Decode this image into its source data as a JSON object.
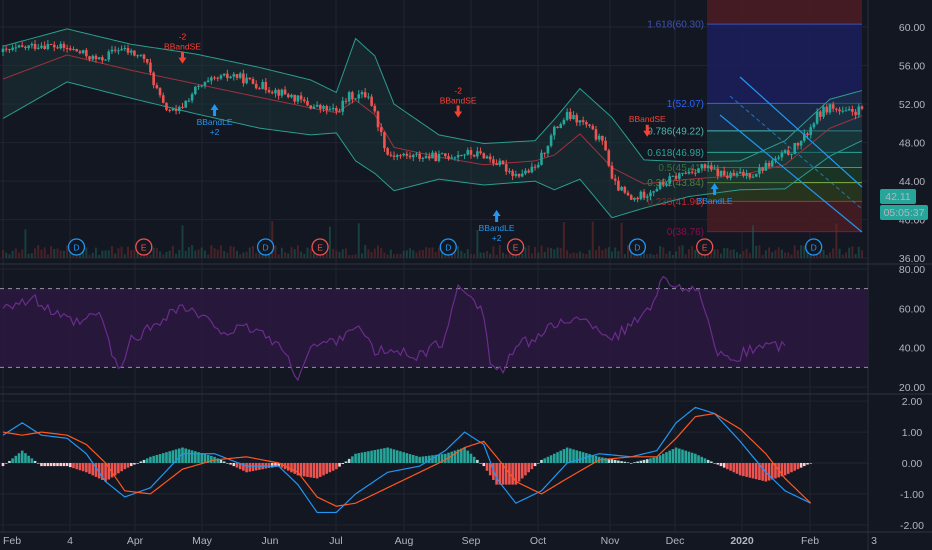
{
  "colors": {
    "background": "#131722",
    "grid": "#1f2430",
    "up": "#26a69a",
    "down": "#ef5350",
    "bb": "#2a9d8f",
    "bb_fill": "#1a3a3a",
    "bb_basis": "#a03040",
    "rsi": "#6b2c8c",
    "rsi_band": "#2a1840",
    "macd": "#2196f3",
    "signal": "#ff5722",
    "fib_blue": "#3f51b5",
    "axis_text": "#b2b5be",
    "price_tag": "#26a69a"
  },
  "chart_data": [
    {
      "type": "line",
      "panel": "price",
      "chart_style": "candlestick with Bollinger Bands",
      "x_labels": [
        "Feb",
        "4",
        "Apr",
        "May",
        "Jun",
        "Jul",
        "Aug",
        "Sep",
        "Oct",
        "Nov",
        "Dec",
        "2020",
        "Feb",
        "3"
      ],
      "y_ticks": [
        "60.00",
        "56.00",
        "52.00",
        "48.00",
        "44.00",
        "40.00",
        "36.00"
      ],
      "ylim": [
        35.5,
        62.8
      ],
      "x_index_range": [
        0,
        268
      ],
      "close_path": [
        [
          0,
          57.4
        ],
        [
          12,
          58.2
        ],
        [
          22,
          57.6
        ],
        [
          30,
          56.5
        ],
        [
          36,
          57.8
        ],
        [
          44,
          56.8
        ],
        [
          50,
          51.8
        ],
        [
          54,
          51.0
        ],
        [
          60,
          53.5
        ],
        [
          66,
          54.5
        ],
        [
          72,
          55.0
        ],
        [
          78,
          54.2
        ],
        [
          84,
          53.5
        ],
        [
          90,
          52.8
        ],
        [
          96,
          51.8
        ],
        [
          104,
          51.2
        ],
        [
          108,
          52.8
        ],
        [
          114,
          53.0
        ],
        [
          116,
          51.0
        ],
        [
          120,
          46.8
        ],
        [
          126,
          46.6
        ],
        [
          136,
          46.5
        ],
        [
          144,
          46.9
        ],
        [
          150,
          46.7
        ],
        [
          160,
          44.7
        ],
        [
          166,
          45.2
        ],
        [
          172,
          49.3
        ],
        [
          176,
          50.8
        ],
        [
          182,
          49.8
        ],
        [
          188,
          47.5
        ],
        [
          190,
          44.0
        ],
        [
          196,
          42.0
        ],
        [
          202,
          43.0
        ],
        [
          210,
          44.5
        ],
        [
          218,
          45.5
        ],
        [
          226,
          44.5
        ],
        [
          234,
          44.8
        ],
        [
          240,
          46.0
        ],
        [
          246,
          47.2
        ],
        [
          250,
          48.5
        ],
        [
          254,
          50.8
        ],
        [
          258,
          51.8
        ],
        [
          262,
          51.0
        ],
        [
          268,
          51.4
        ]
      ],
      "bb_upper_path": [
        [
          0,
          58.0
        ],
        [
          20,
          59.8
        ],
        [
          40,
          58.2
        ],
        [
          60,
          57.2
        ],
        [
          80,
          55.8
        ],
        [
          96,
          54.5
        ],
        [
          104,
          53.2
        ],
        [
          110,
          58.8
        ],
        [
          116,
          57.0
        ],
        [
          122,
          52.0
        ],
        [
          136,
          48.8
        ],
        [
          150,
          47.9
        ],
        [
          166,
          48.2
        ],
        [
          172,
          50.4
        ],
        [
          180,
          53.6
        ],
        [
          190,
          50.6
        ],
        [
          200,
          46.2
        ],
        [
          214,
          46.0
        ],
        [
          230,
          46.1
        ],
        [
          244,
          48.2
        ],
        [
          258,
          52.5
        ],
        [
          268,
          53.4
        ]
      ],
      "bb_lower_path": [
        [
          0,
          50.5
        ],
        [
          20,
          54.3
        ],
        [
          40,
          52.6
        ],
        [
          60,
          51.0
        ],
        [
          80,
          49.5
        ],
        [
          96,
          48.8
        ],
        [
          104,
          49.0
        ],
        [
          110,
          46.1
        ],
        [
          116,
          44.8
        ],
        [
          122,
          43.0
        ],
        [
          136,
          44.2
        ],
        [
          150,
          43.6
        ],
        [
          166,
          44.0
        ],
        [
          172,
          43.1
        ],
        [
          180,
          44.2
        ],
        [
          190,
          40.2
        ],
        [
          200,
          41.2
        ],
        [
          214,
          42.4
        ],
        [
          230,
          43.1
        ],
        [
          244,
          43.2
        ],
        [
          258,
          46.6
        ],
        [
          268,
          48.2
        ]
      ],
      "bb_basis_path": [
        [
          0,
          54.6
        ],
        [
          20,
          57.1
        ],
        [
          40,
          55.5
        ],
        [
          60,
          54.1
        ],
        [
          80,
          52.7
        ],
        [
          96,
          51.6
        ],
        [
          104,
          51.1
        ],
        [
          110,
          52.4
        ],
        [
          116,
          50.9
        ],
        [
          122,
          47.5
        ],
        [
          136,
          46.5
        ],
        [
          150,
          45.7
        ],
        [
          166,
          46.1
        ],
        [
          172,
          46.7
        ],
        [
          180,
          48.9
        ],
        [
          190,
          45.4
        ],
        [
          200,
          43.7
        ],
        [
          214,
          44.2
        ],
        [
          230,
          44.6
        ],
        [
          244,
          45.7
        ],
        [
          258,
          49.5
        ],
        [
          268,
          50.8
        ]
      ],
      "current_price": "42.11",
      "countdown": "05:05:37",
      "fibonacci": [
        {
          "label": "1.618(60.30)",
          "value": 60.3
        },
        {
          "label": "1(52.07)",
          "value": 52.07
        },
        {
          "label": "0.786(49.22)",
          "value": 49.22
        },
        {
          "label": "0.618(46.98)",
          "value": 46.98
        },
        {
          "label": "0.5(45.41)",
          "value": 45.41
        },
        {
          "label": "0.382(43.84)",
          "value": 43.84
        },
        {
          "label": "0.236(41.90)",
          "value": 41.9
        },
        {
          "label": "0(38.76)",
          "value": 38.76
        }
      ],
      "signals": [
        {
          "text": "-2",
          "text2": "BBandSE",
          "kind": "sell",
          "x": 56,
          "y": 56.2
        },
        {
          "text": "BBandLE",
          "text2": "+2",
          "kind": "buy",
          "x": 66,
          "y": 52.0
        },
        {
          "text": "-2",
          "text2": "BBandSE",
          "kind": "sell",
          "x": 142,
          "y": 50.6
        },
        {
          "text": "BBandLE",
          "text2": "+2",
          "kind": "buy",
          "x": 154,
          "y": 41.0
        },
        {
          "text": "BBandSE",
          "text2": "",
          "kind": "sell",
          "x": 201,
          "y": 48.6
        },
        {
          "text": "BBandLE",
          "text2": "",
          "kind": "buy",
          "x": 222,
          "y": 43.8
        }
      ],
      "events": [
        {
          "label": "D",
          "kind": "dividend",
          "x": 12
        },
        {
          "label": "E",
          "kind": "earnings",
          "x": 33
        },
        {
          "label": "D",
          "kind": "dividend",
          "x": 71
        },
        {
          "label": "E",
          "kind": "earnings",
          "x": 88
        },
        {
          "label": "D",
          "kind": "dividend",
          "x": 128
        },
        {
          "label": "E",
          "kind": "earnings",
          "x": 149
        },
        {
          "label": "D",
          "kind": "dividend",
          "x": 187
        },
        {
          "label": "E",
          "kind": "earnings",
          "x": 208
        },
        {
          "label": "D",
          "kind": "dividend",
          "x": 242
        }
      ]
    },
    {
      "type": "line",
      "panel": "rsi",
      "y_ticks": [
        "80.00",
        "60.00",
        "40.00",
        "20.00"
      ],
      "ylim": [
        17,
        82
      ],
      "bands": [
        70,
        30
      ],
      "path": [
        [
          0,
          62
        ],
        [
          10,
          64
        ],
        [
          18,
          55
        ],
        [
          24,
          52
        ],
        [
          30,
          58
        ],
        [
          34,
          38
        ],
        [
          36,
          27
        ],
        [
          40,
          44
        ],
        [
          46,
          50
        ],
        [
          52,
          58
        ],
        [
          56,
          61
        ],
        [
          62,
          55
        ],
        [
          70,
          48
        ],
        [
          78,
          50
        ],
        [
          86,
          42
        ],
        [
          90,
          30
        ],
        [
          92,
          26
        ],
        [
          96,
          40
        ],
        [
          104,
          44
        ],
        [
          110,
          52
        ],
        [
          116,
          38
        ],
        [
          122,
          38
        ],
        [
          130,
          36
        ],
        [
          138,
          44
        ],
        [
          142,
          72
        ],
        [
          146,
          68
        ],
        [
          150,
          57
        ],
        [
          152,
          32
        ],
        [
          156,
          28
        ],
        [
          160,
          40
        ],
        [
          168,
          47
        ],
        [
          176,
          55
        ],
        [
          184,
          52
        ],
        [
          190,
          45
        ],
        [
          196,
          51
        ],
        [
          202,
          62
        ],
        [
          206,
          75
        ],
        [
          212,
          71
        ],
        [
          218,
          66
        ],
        [
          222,
          38
        ],
        [
          226,
          33
        ],
        [
          232,
          38
        ],
        [
          238,
          42
        ],
        [
          244,
          40
        ]
      ]
    },
    {
      "type": "line",
      "panel": "macd",
      "y_ticks": [
        "2.00",
        "1.00",
        "0.00",
        "-1.00",
        "-2.00"
      ],
      "ylim": [
        -2.2,
        2.2
      ],
      "series": [
        {
          "kind": "macd",
          "values": [
            [
              0,
              0.9
            ],
            [
              6,
              1.3
            ],
            [
              12,
              0.9
            ],
            [
              20,
              0.8
            ],
            [
              26,
              0.3
            ],
            [
              32,
              -0.6
            ],
            [
              38,
              -1.1
            ],
            [
              46,
              -0.8
            ],
            [
              56,
              0.3
            ],
            [
              66,
              0.3
            ],
            [
              76,
              -0.1
            ],
            [
              86,
              -0.1
            ],
            [
              92,
              -0.7
            ],
            [
              98,
              -1.6
            ],
            [
              104,
              -1.6
            ],
            [
              110,
              -1.0
            ],
            [
              120,
              -0.3
            ],
            [
              130,
              -0.1
            ],
            [
              138,
              0.4
            ],
            [
              144,
              1.0
            ],
            [
              150,
              0.6
            ],
            [
              154,
              -0.5
            ],
            [
              160,
              -1.3
            ],
            [
              168,
              -0.9
            ],
            [
              176,
              0.0
            ],
            [
              186,
              0.3
            ],
            [
              196,
              0.2
            ],
            [
              204,
              0.4
            ],
            [
              210,
              1.3
            ],
            [
              216,
              1.8
            ],
            [
              222,
              1.6
            ],
            [
              230,
              0.7
            ],
            [
              238,
              -0.3
            ],
            [
              244,
              -0.9
            ],
            [
              252,
              -1.3
            ]
          ]
        },
        {
          "kind": "signal",
          "values": [
            [
              0,
              1.0
            ],
            [
              6,
              0.9
            ],
            [
              12,
              1.0
            ],
            [
              20,
              0.9
            ],
            [
              26,
              0.6
            ],
            [
              32,
              0.0
            ],
            [
              38,
              -0.9
            ],
            [
              46,
              -1.0
            ],
            [
              56,
              -0.2
            ],
            [
              66,
              0.1
            ],
            [
              76,
              0.2
            ],
            [
              86,
              0.0
            ],
            [
              92,
              -0.3
            ],
            [
              98,
              -1.1
            ],
            [
              104,
              -1.4
            ],
            [
              110,
              -1.3
            ],
            [
              120,
              -0.8
            ],
            [
              130,
              -0.3
            ],
            [
              138,
              0.1
            ],
            [
              144,
              0.5
            ],
            [
              150,
              0.7
            ],
            [
              154,
              0.2
            ],
            [
              160,
              -0.6
            ],
            [
              168,
              -1.0
            ],
            [
              176,
              -0.5
            ],
            [
              186,
              0.1
            ],
            [
              196,
              0.2
            ],
            [
              204,
              0.2
            ],
            [
              210,
              0.8
            ],
            [
              216,
              1.5
            ],
            [
              222,
              1.6
            ],
            [
              230,
              1.1
            ],
            [
              238,
              0.3
            ],
            [
              244,
              -0.5
            ],
            [
              252,
              -1.3
            ]
          ]
        }
      ]
    }
  ]
}
